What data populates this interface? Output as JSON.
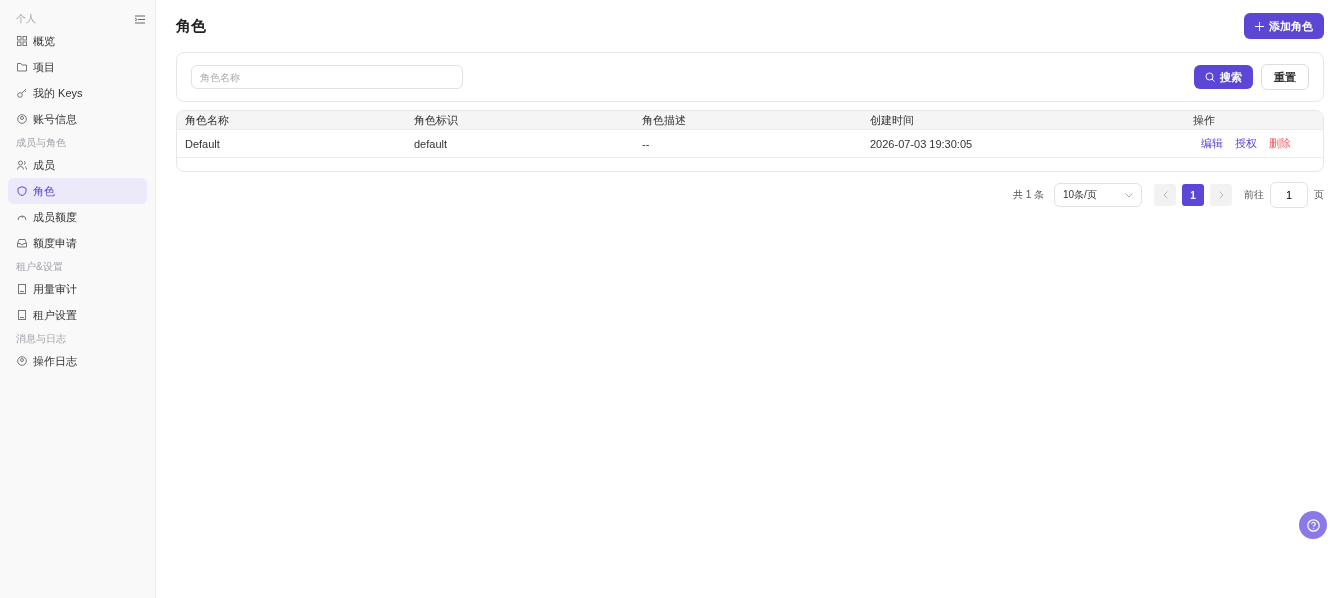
{
  "sidebar": {
    "groups": [
      {
        "label": "个人",
        "items": [
          {
            "label": "概览",
            "selected": false
          },
          {
            "label": "项目",
            "selected": false
          },
          {
            "label": "我的 Keys",
            "selected": false
          },
          {
            "label": "账号信息",
            "selected": false
          }
        ]
      },
      {
        "label": "成员与角色",
        "items": [
          {
            "label": "成员",
            "selected": false
          },
          {
            "label": "角色",
            "selected": true
          },
          {
            "label": "成员额度",
            "selected": false
          },
          {
            "label": "额度申请",
            "selected": false
          }
        ]
      },
      {
        "label": "租户&设置",
        "items": [
          {
            "label": "用量审计",
            "selected": false
          },
          {
            "label": "租户设置",
            "selected": false
          }
        ]
      },
      {
        "label": "消息与日志",
        "items": [
          {
            "label": "操作日志",
            "selected": false
          }
        ]
      }
    ]
  },
  "page": {
    "title": "角色",
    "add_button": "添加角色"
  },
  "filter": {
    "placeholder": "角色名称",
    "search_button": "搜索",
    "reset_button": "重置"
  },
  "table": {
    "columns": [
      "角色名称",
      "角色标识",
      "角色描述",
      "创建时间",
      "操作"
    ],
    "rows": [
      {
        "cells": [
          "Default",
          "default",
          "--",
          "2026-07-03 19:30:05"
        ],
        "actions": [
          {
            "label": "编辑",
            "kind": "normal"
          },
          {
            "label": "授权",
            "kind": "normal"
          },
          {
            "label": "删除",
            "kind": "danger"
          }
        ]
      }
    ]
  },
  "pagination": {
    "total": "共 1 条",
    "page_size": "10条/页",
    "pages": [
      {
        "label": "1",
        "selected": true
      }
    ],
    "goto_label": "前往",
    "goto_value": "1",
    "goto_suffix": "页"
  }
}
